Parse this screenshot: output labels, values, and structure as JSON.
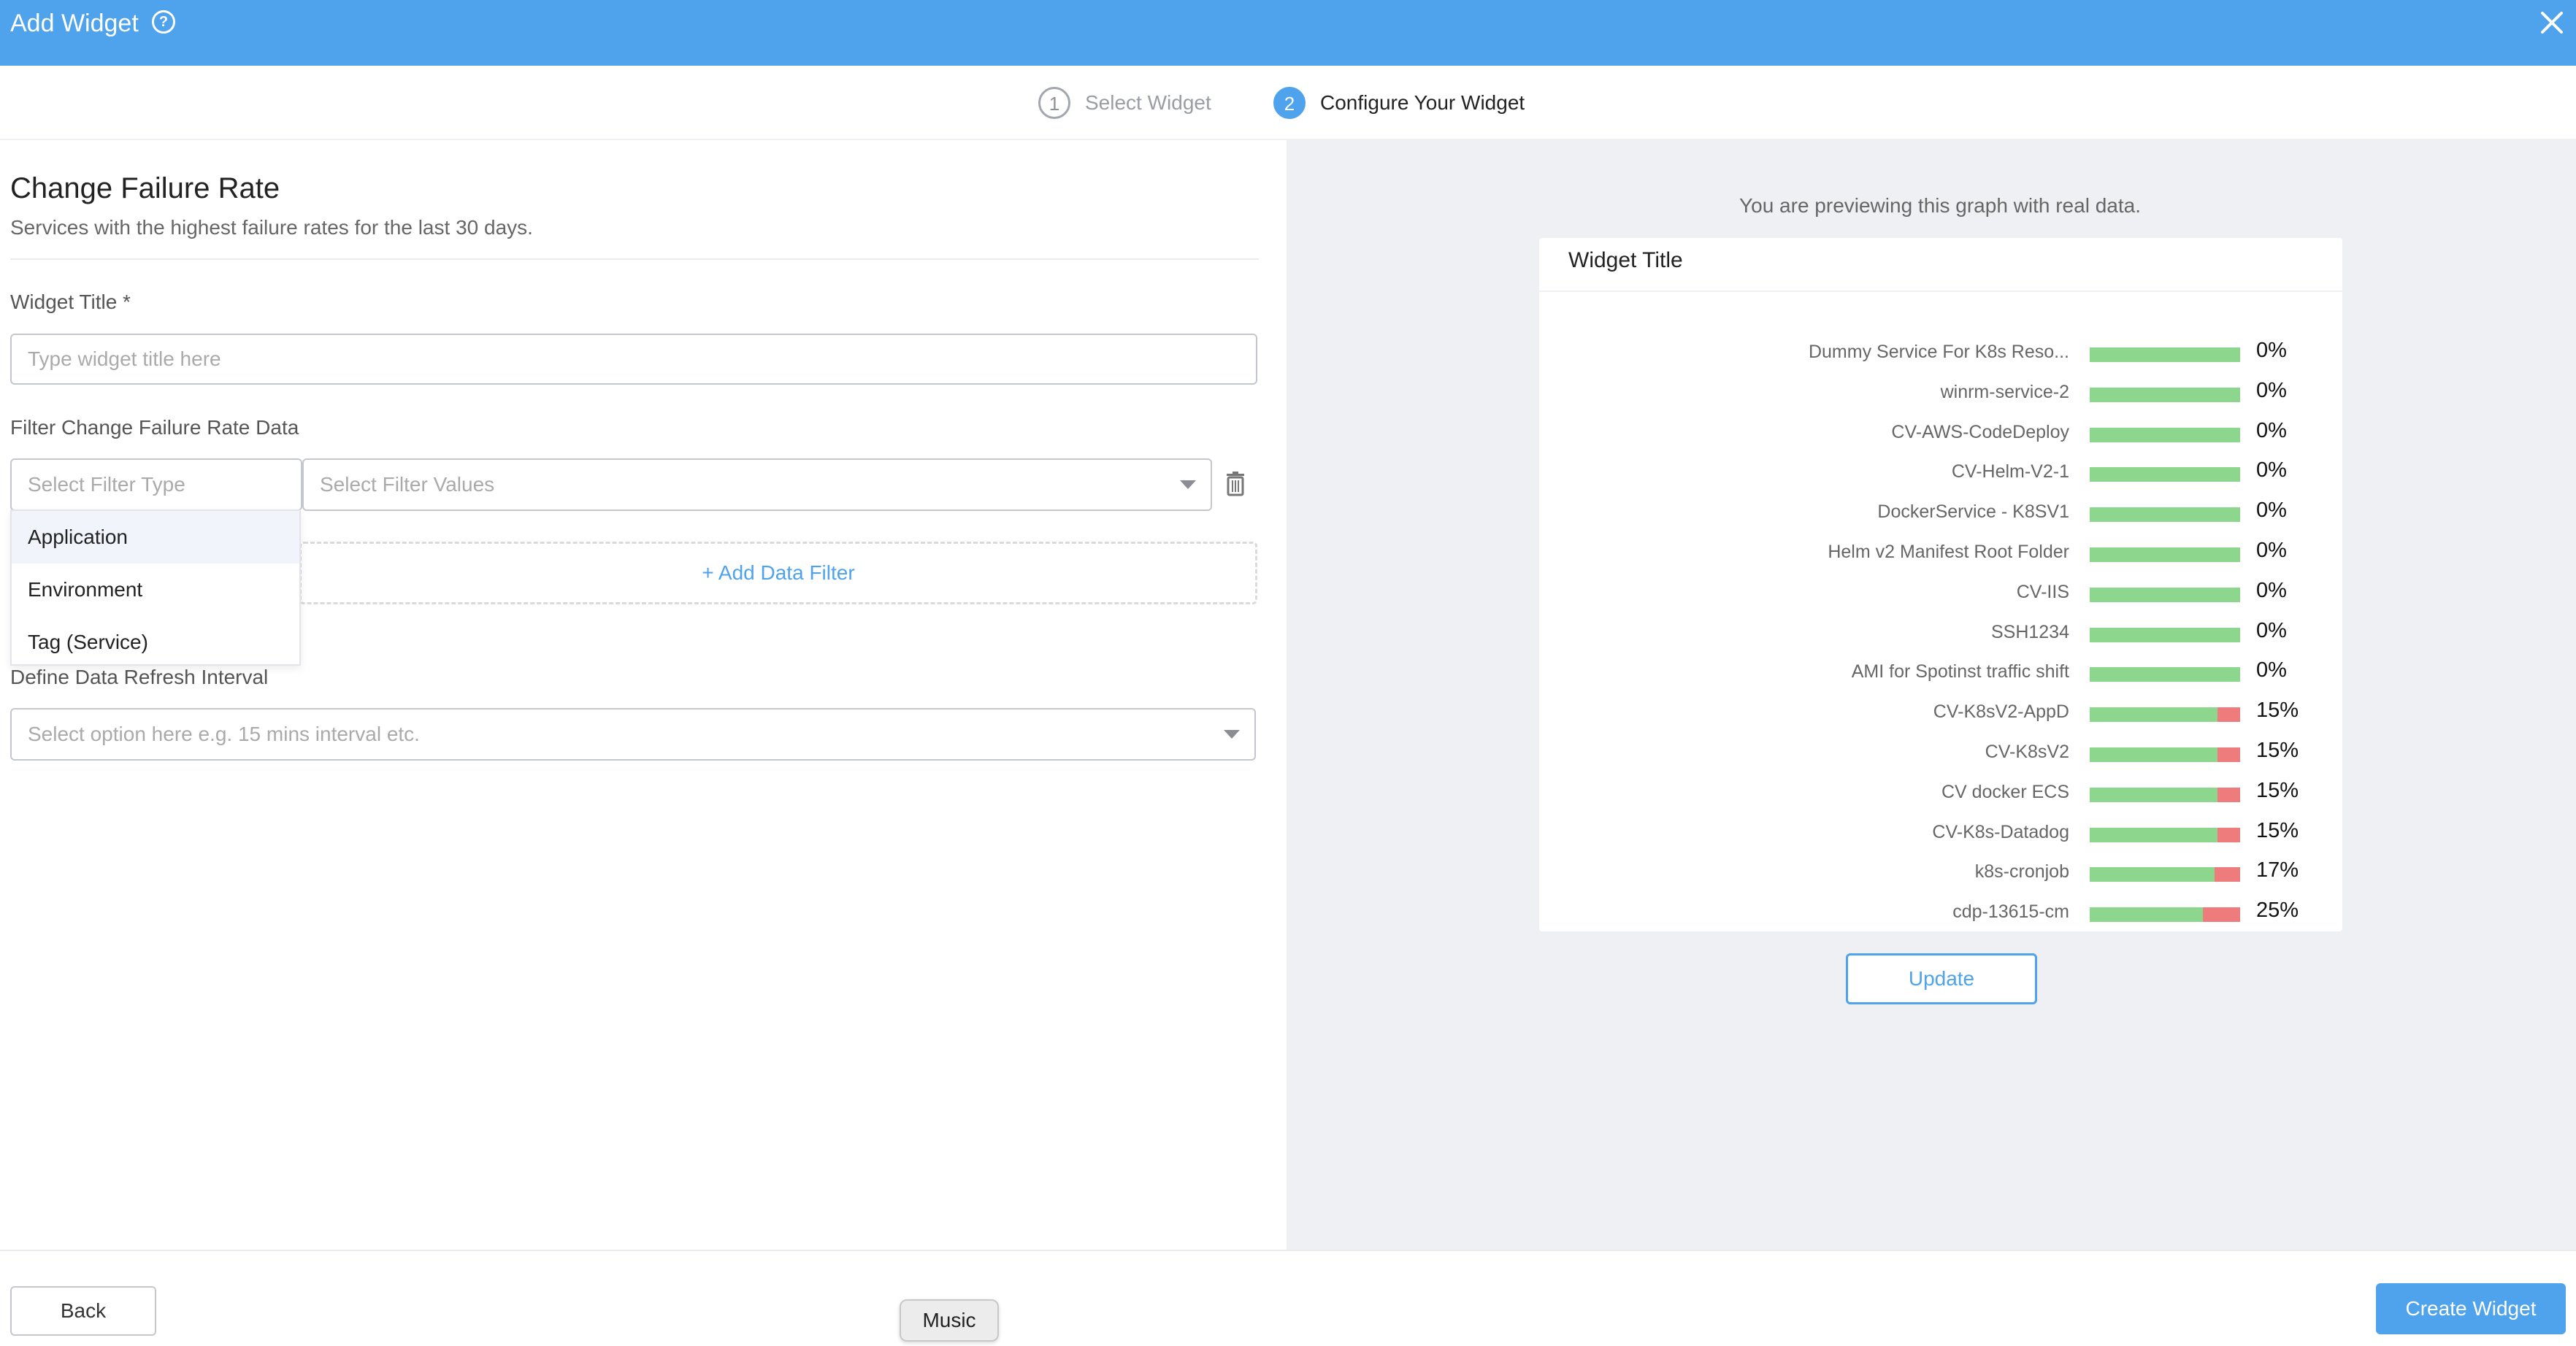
{
  "header": {
    "title": "Add Widget",
    "help_icon": "question-circle-icon",
    "close_icon": "close-icon",
    "color": "#4fa2ec"
  },
  "stepper": {
    "steps": [
      {
        "number": "1",
        "label": "Select Widget",
        "state": "done"
      },
      {
        "number": "2",
        "label": "Configure Your Widget",
        "state": "active"
      }
    ]
  },
  "form": {
    "title": "Change Failure Rate",
    "subtitle": "Services with the highest failure rates for the last 30 days.",
    "widget_title_label": "Widget Title *",
    "widget_title_placeholder": "Type widget title here",
    "filter_label": "Filter Change Failure Rate Data",
    "filter_type_placeholder": "Select Filter Type",
    "filter_values_placeholder": "Select Filter Values",
    "filter_type_options": [
      "Application",
      "Environment",
      "Tag (Service)"
    ],
    "add_filter_label": "+ Add Data Filter",
    "refresh_label": "Define Data Refresh Interval",
    "refresh_placeholder": "Select option here e.g. 15 mins interval etc."
  },
  "preview": {
    "note": "You are previewing this graph with real data.",
    "card_title": "Widget Title",
    "update_label": "Update",
    "colors": {
      "success": "#8cd68d",
      "failure": "#ef7c7c"
    }
  },
  "chart_data": {
    "type": "bar",
    "orientation": "horizontal",
    "stacked": true,
    "categories": [
      "Dummy Service For K8s Reso...",
      "winrm-service-2",
      "CV-AWS-CodeDeploy",
      "CV-Helm-V2-1",
      "DockerService - K8SV1",
      "Helm v2 Manifest Root Folder",
      "CV-IIS",
      "SSH1234",
      "AMI for Spotinst traffic shift",
      "CV-K8sV2-AppD",
      "CV-K8sV2",
      "CV docker ECS",
      "CV-K8s-Datadog",
      "k8s-cronjob",
      "cdp-13615-cm"
    ],
    "values": [
      0,
      0,
      0,
      0,
      0,
      0,
      0,
      0,
      0,
      15,
      15,
      15,
      15,
      17,
      25
    ],
    "value_labels": [
      "0%",
      "0%",
      "0%",
      "0%",
      "0%",
      "0%",
      "0%",
      "0%",
      "0%",
      "15%",
      "15%",
      "15%",
      "15%",
      "17%",
      "25%"
    ],
    "xlim": [
      0,
      100
    ],
    "title": "Widget Title"
  },
  "footer": {
    "back_label": "Back",
    "create_label": "Create Widget",
    "tooltip": "Music"
  }
}
